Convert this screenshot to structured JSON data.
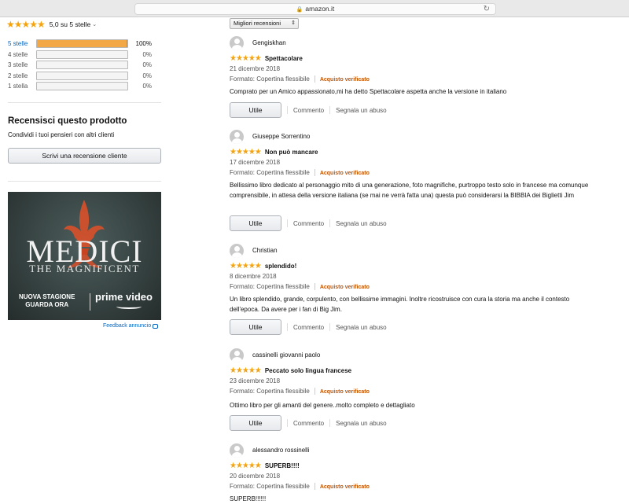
{
  "browser": {
    "url": "amazon.it"
  },
  "summary": {
    "rating_text": "5,0 su 5 stelle",
    "stars": "★★★★★",
    "histogram": [
      {
        "label": "5 stelle",
        "pct": "100%",
        "fill": 1.0
      },
      {
        "label": "4 stelle",
        "pct": "0%",
        "fill": 0
      },
      {
        "label": "3 stelle",
        "pct": "0%",
        "fill": 0
      },
      {
        "label": "2 stelle",
        "pct": "0%",
        "fill": 0
      },
      {
        "label": "1 stella",
        "pct": "0%",
        "fill": 0
      }
    ]
  },
  "write_review": {
    "heading": "Recensisci questo prodotto",
    "subtext": "Condividi i tuoi pensieri con altri clienti",
    "button": "Scrivi una recensione cliente"
  },
  "ad": {
    "title": "MEDICI",
    "subtitle": "THE MAGNIFICENT",
    "line1": "NUOVA STAGIONE",
    "line2": "GUARDA ORA",
    "brand": "prime video",
    "feedback": "Feedback annuncio"
  },
  "sort": {
    "selected": "Migliori recensioni"
  },
  "review_common": {
    "stars": "★★★★★",
    "verified": "Acquisto verificato",
    "helpful": "Utile",
    "comment": "Commento",
    "report": "Segnala un abuso"
  },
  "reviews": [
    {
      "name": "Gengiskhan",
      "title": "Spettacolare",
      "date": "21 dicembre 2018",
      "format": "Formato: Copertina flessibile",
      "body": "Comprato per un Amico appassionato,mi ha detto Spettacolare aspetta anche la versione in italiano"
    },
    {
      "name": "Giuseppe Sorrentino",
      "title": "Non può mancare",
      "date": "17 dicembre 2018",
      "format": "Formato: Copertina flessibile",
      "body": "Bellissimo libro dedicato al personaggio mito di una generazione, foto magnifiche, purtroppo testo solo in francese ma comunque comprensibile, in attesa della versione italiana (se mai ne verrà fatta una) questa può considerarsi la BIBBIA dei Biglietti Jim"
    },
    {
      "name": "Christian",
      "title": "splendido!",
      "date": "8 dicembre 2018",
      "format": "Formato: Copertina flessibile",
      "body": "Un libro splendido, grande, corpulento, con bellissime immagini. Inoltre ricostruisce con cura la storia ma anche il contesto dell'epoca. Da avere per i fan di Big Jim."
    },
    {
      "name": "cassinelli giovanni paolo",
      "title": "Peccato solo lingua francese",
      "date": "23 dicembre 2018",
      "format": "Formato: Copertina flessibile",
      "body": "Ottimo libro per gli amanti del genere..molto completo e dettagliato"
    },
    {
      "name": "alessandro rossinelli",
      "title": "SUPERB!!!!",
      "date": "20 dicembre 2018",
      "format": "Formato: Copertina flessibile",
      "body": "SUPERB!!!!!!"
    }
  ]
}
